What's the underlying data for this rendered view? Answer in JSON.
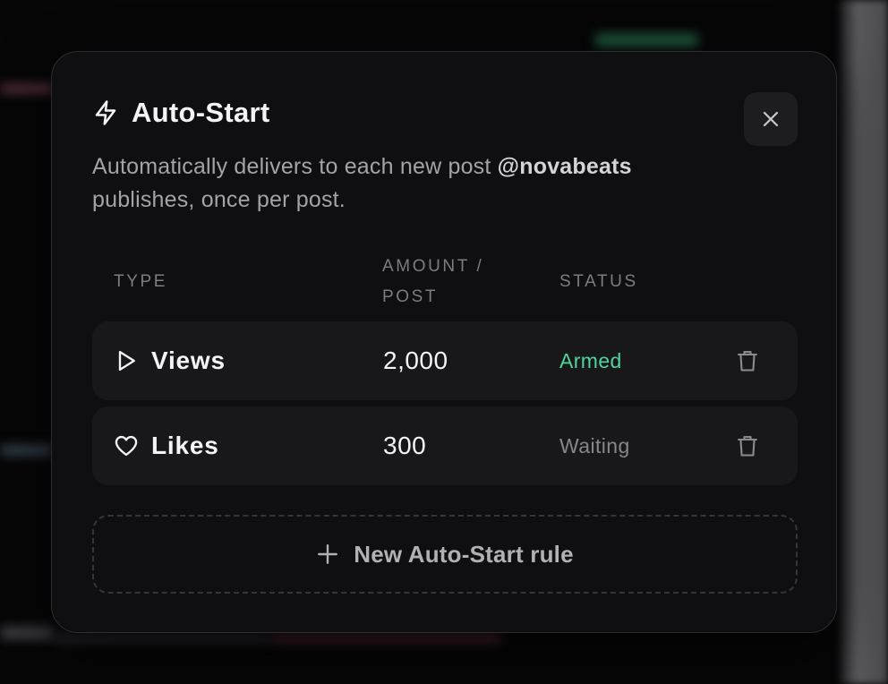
{
  "modal": {
    "title": "Auto-Start",
    "description_prefix": "Automatically delivers to each new post ",
    "handle": "@novabeats",
    "description_suffix": " publishes, once per post.",
    "close_icon": "close-icon",
    "title_icon": "lightning-bolt-icon"
  },
  "table": {
    "headers": {
      "type": "TYPE",
      "amount": "AMOUNT / POST",
      "status": "STATUS"
    },
    "rows": [
      {
        "type": "Views",
        "icon": "play-icon",
        "amount": "2,000",
        "status": "Armed",
        "status_color": "#4fd49a"
      },
      {
        "type": "Likes",
        "icon": "heart-icon",
        "amount": "300",
        "status": "Waiting",
        "status_color": "#86868c"
      }
    ]
  },
  "new_rule": {
    "label": "New Auto-Start rule",
    "icon": "plus-icon"
  },
  "colors": {
    "accent_green": "#4fd49a",
    "modal_bg": "#0f0f11",
    "row_bg": "#18181b"
  }
}
